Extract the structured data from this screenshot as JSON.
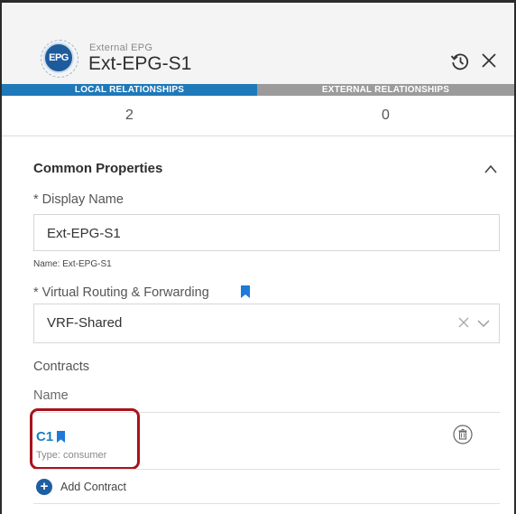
{
  "header": {
    "icon_label": "EPG",
    "subtitle": "External EPG",
    "title": "Ext-EPG-S1",
    "icons": [
      "history-icon",
      "close-icon"
    ]
  },
  "tabs": [
    {
      "label": "LOCAL RELATIONSHIPS",
      "count": "2",
      "active": true
    },
    {
      "label": "EXTERNAL RELATIONSHIPS",
      "count": "0",
      "active": false
    }
  ],
  "section": {
    "title": "Common Properties",
    "display_name_label": "* Display Name",
    "display_name_value": "Ext-EPG-S1",
    "name_hint": "Name: Ext-EPG-S1",
    "vrf_label": "* Virtual Routing & Forwarding",
    "vrf_value": "VRF-Shared",
    "contracts_label": "Contracts",
    "contracts_column": "Name",
    "contracts": [
      {
        "name": "C1",
        "type": "Type: consumer"
      }
    ],
    "add_contract_label": "Add Contract",
    "add_icon_glyph": "+"
  },
  "colors": {
    "accent_blue": "#1f79b9",
    "link_blue": "#1a80c4",
    "tab_inactive": "#9b9b9b",
    "highlight_red": "#a8131b"
  }
}
